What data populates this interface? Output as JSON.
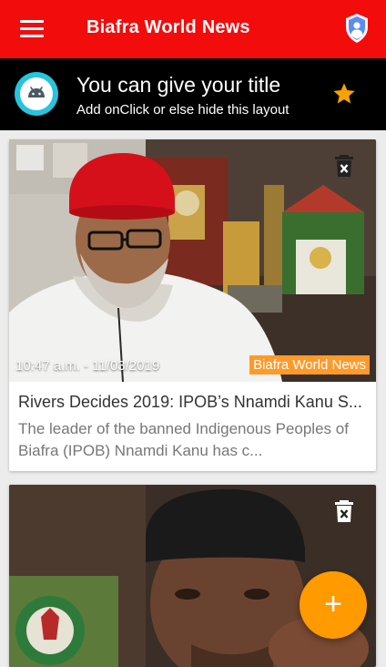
{
  "appbar": {
    "title": "Biafra World News",
    "menu_icon": "hamburger-menu-icon",
    "account_icon": "shield-account-icon",
    "background": "#f20c0c"
  },
  "banner": {
    "title": "You can give your title",
    "subtitle": "Add onClick or else hide this layout",
    "logo_icon": "android-icon",
    "star_icon": "star-icon",
    "star_color": "#f5a300"
  },
  "articles": [
    {
      "time": "10:47 a.m. - 11/03/2019",
      "source": "Biafra World News",
      "title": "Rivers Decides 2019: IPOB’s Nnamdi Kanu S...",
      "description": "The leader of the banned Indigenous Peoples of Biafra (IPOB) Nnamdi Kanu has c...",
      "image": "photo-man-red-cap",
      "delete_icon": "delete-icon"
    },
    {
      "image": "photo-man-black-cap",
      "delete_icon": "delete-icon"
    }
  ],
  "fab": {
    "label": "+",
    "icon": "add-icon",
    "color": "#ff9a00"
  }
}
